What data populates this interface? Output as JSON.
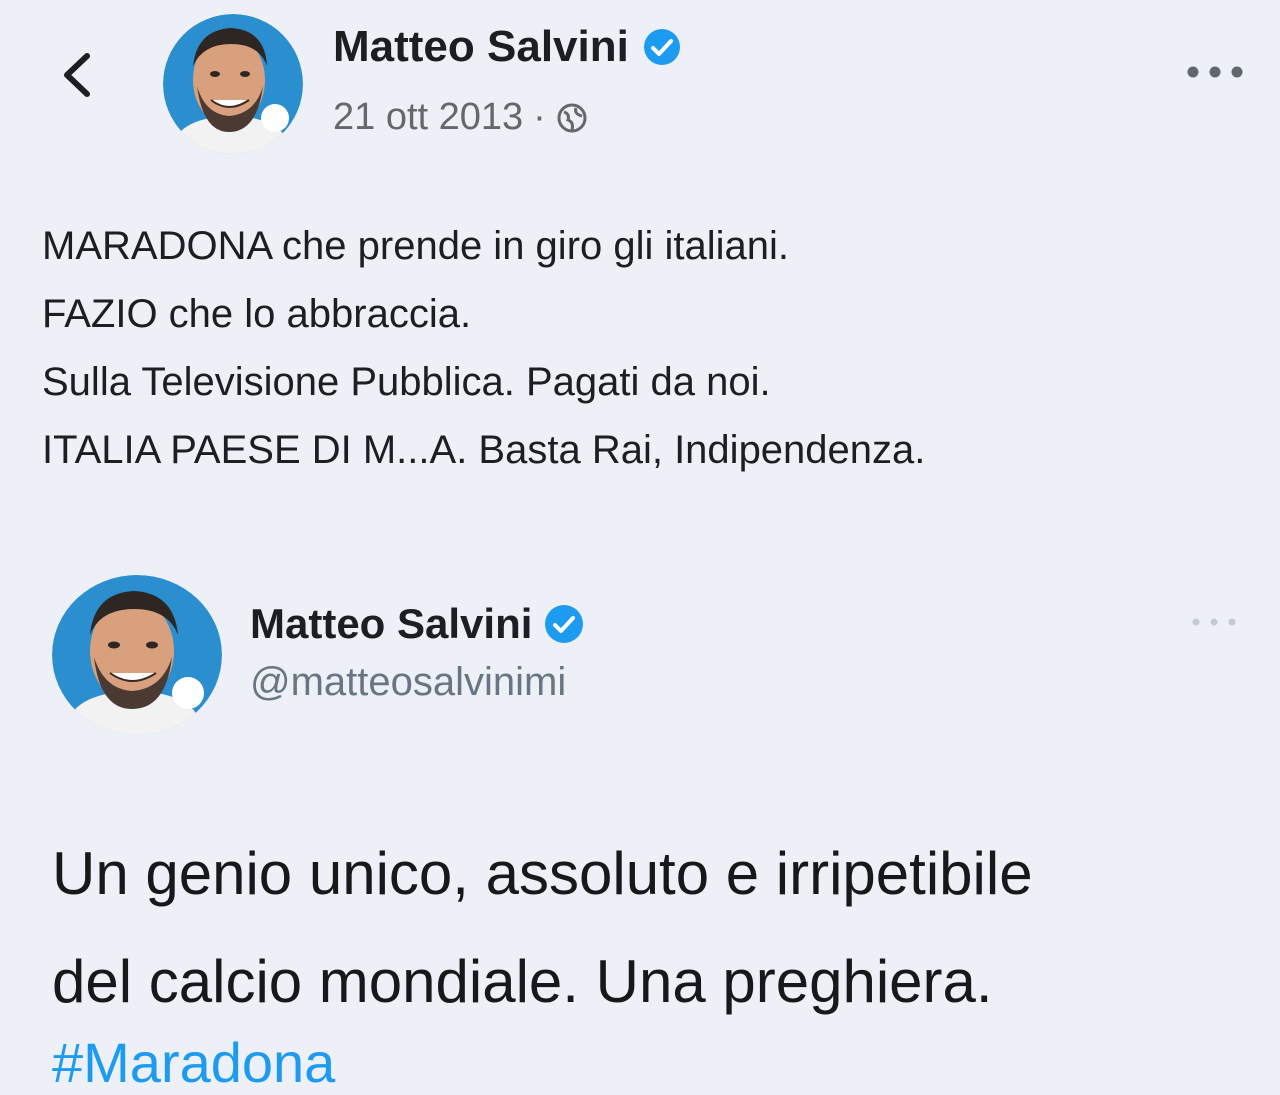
{
  "post": {
    "author_name": "Matteo Salvini",
    "date": "21 ott 2013",
    "date_separator": "·",
    "audience_icon": "globe-icon",
    "verified_icon": "verified-badge-icon",
    "back_icon": "chevron-left-icon",
    "more_icon": "more-horizontal-icon",
    "lines": [
      "MARADONA che prende in giro gli italiani.",
      "FAZIO che lo abbraccia.",
      "Sulla Televisione Pubblica. Pagati da noi.",
      "ITALIA PAESE DI M...A. Basta Rai, Indipendenza."
    ]
  },
  "tweet": {
    "author_name": "Matteo Salvini",
    "handle": "@matteosalvinimi",
    "verified_icon": "verified-badge-icon",
    "more_icon": "more-horizontal-icon",
    "lines": [
      "Un genio unico, assoluto e irripetibile",
      "del calcio mondiale. Una preghiera."
    ],
    "hashtag": "#Maradona"
  },
  "colors": {
    "background": "#edf0f6",
    "verified_blue": "#1d9bf0",
    "avatar_ring": "#2b8ecf",
    "secondary_text": "#65676b",
    "hashtag": "#1d9bf0"
  }
}
